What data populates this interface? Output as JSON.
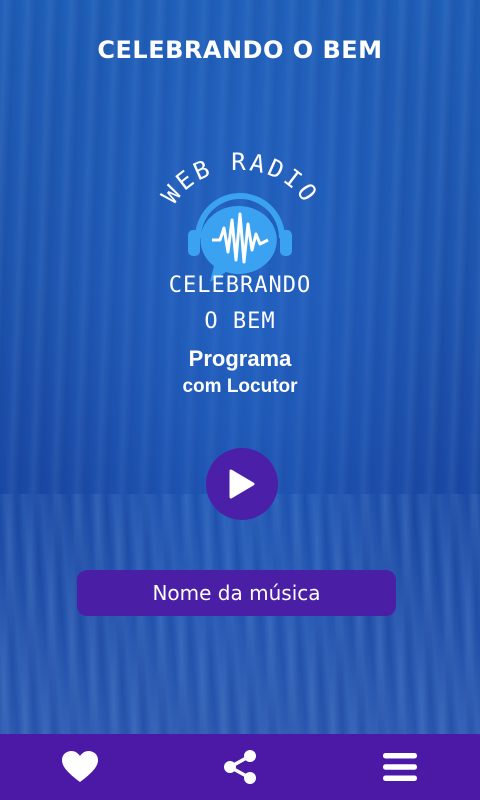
{
  "header": {
    "title": "CELEBRANDO O BEM"
  },
  "logo": {
    "arc_text": "WEB RADIO",
    "line1": "CELEBRANDO",
    "line2": "O BEM"
  },
  "program": {
    "line1": "Programa",
    "line2": "com Locutor"
  },
  "player": {
    "song_name": "Nome da música",
    "play_icon": "play-icon"
  },
  "bottom_nav": {
    "items": [
      "heart-icon",
      "share-icon",
      "menu-icon"
    ]
  },
  "colors": {
    "accent": "#4b19a5",
    "background": "#1e56b0",
    "logo_blue": "#3aa2f0"
  }
}
